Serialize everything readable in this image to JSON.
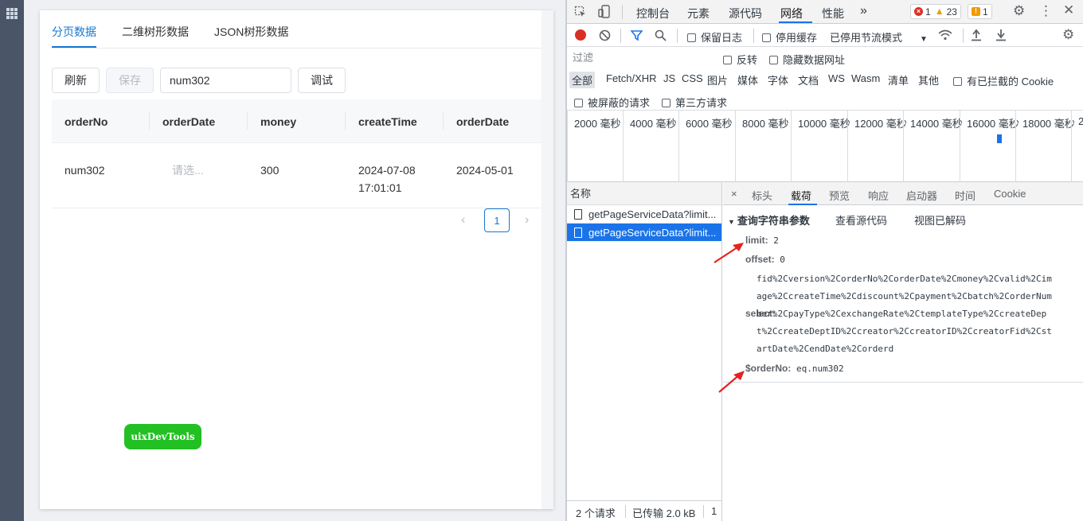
{
  "app": {
    "tabs": [
      "分页数据",
      "二维树形数据",
      "JSON树形数据"
    ],
    "toolbar": {
      "refresh": "刷新",
      "save": "保存",
      "search_value": "num302",
      "debug": "调试"
    },
    "table": {
      "columns": [
        "orderNo",
        "orderDate",
        "money",
        "createTime",
        "orderDate"
      ],
      "rows": [
        {
          "orderNo": "num302",
          "orderDate_placeholder": "请选...",
          "money": "300",
          "createTime_date": "2024-07-08",
          "createTime_time": "17:01:01",
          "orderDate": "2024-05-01"
        }
      ]
    },
    "pager": {
      "prev": "‹",
      "page": "1",
      "next": "›"
    },
    "uix_button": "uixDevTools"
  },
  "devtools": {
    "top_tabs": [
      "控制台",
      "元素",
      "源代码",
      "网络",
      "性能",
      "»"
    ],
    "badges": {
      "errors": "1",
      "warnings": "23",
      "issues": "1"
    },
    "network_toolbar": {
      "preserve_log": "保留日志",
      "disable_cache": "停用缓存",
      "throttle": "已停用节流模式"
    },
    "filter": {
      "placeholder": "过滤",
      "invert": "反转",
      "hide_data_urls": "隐藏数据网址"
    },
    "type_filters": [
      "全部",
      "Fetch/XHR",
      "JS",
      "CSS",
      "图片",
      "媒体",
      "字体",
      "文档",
      "WS",
      "Wasm",
      "清单",
      "其他"
    ],
    "blocked_cookies": "有已拦截的 Cookie",
    "blocked_requests": "被屏蔽的请求",
    "third_party": "第三方请求",
    "timeline_labels": [
      "2000 毫秒",
      "4000 毫秒",
      "6000 毫秒",
      "8000 毫秒",
      "10000 毫秒",
      "12000 毫秒",
      "14000 毫秒",
      "16000 毫秒",
      "18000 毫秒",
      "2"
    ],
    "names_header": "名称",
    "requests": [
      "getPageServiceData?limit...",
      "getPageServiceData?limit..."
    ],
    "status": {
      "requests": "2 个请求",
      "transferred": "已传输 2.0 kB",
      "extra": "1"
    },
    "detail_tabs": [
      "×",
      "标头",
      "载荷",
      "预览",
      "响应",
      "启动器",
      "时间",
      "Cookie"
    ],
    "query": {
      "header": "查询字符串参数",
      "view_source": "查看源代码",
      "view_decoded": "视图已解码",
      "limit_key": "limit:",
      "limit_val": "2",
      "offset_key": "offset:",
      "offset_val": "0",
      "select_key": "select:",
      "select_lines": [
        "fid%2Cversion%2CorderNo%2CorderDate%2Cmoney%2Cvalid%2Cim",
        "age%2CcreateTime%2Cdiscount%2Cpayment%2Cbatch%2CorderNum",
        "ber%2CpayType%2CexchangeRate%2CtemplateType%2CcreateDep",
        "t%2CcreateDeptID%2Ccreator%2CcreatorID%2CcreatorFid%2Cst",
        "artDate%2CendDate%2Corderd"
      ],
      "orderno_key": "$orderNo:",
      "orderno_val": "eq.num302"
    }
  },
  "colors": {
    "primary": "#1677d2",
    "devtools_accent": "#1a73e8",
    "uix_green": "#22c022",
    "annotation_red": "#e32323"
  }
}
